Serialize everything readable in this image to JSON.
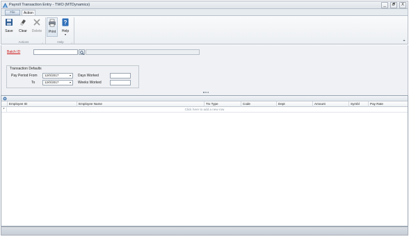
{
  "window": {
    "title": "Payroll Transaction Entry  -  TWO (MTDynamics)",
    "controls": {
      "minimize": "_",
      "restore": "🗗",
      "close": "X"
    }
  },
  "ribbon": {
    "tabs": {
      "file": "File",
      "action": "Action"
    },
    "buttons": {
      "save": "Save",
      "clear": "Clear",
      "delete": "Delete",
      "print": "Print",
      "help": "Help"
    },
    "groups": {
      "actions": "Actions",
      "help": "Help"
    }
  },
  "form": {
    "batch_id_label": "Batch ID",
    "batch_id_value": "",
    "transaction_defaults_label": "Transaction Defaults",
    "pay_period_from_label": "Pay Period From",
    "pay_period_from_value": "12/0/2017",
    "to_label": "To",
    "to_value": "12/0/2017",
    "days_worked_label": "Days Worked",
    "weeks_worked_label": "Weeks Worked"
  },
  "grid": {
    "columns": [
      "Employee ID",
      "Employee Name",
      "Trx Type",
      "Code",
      "Dept",
      "Amount",
      "Symbl",
      "Pay Rate"
    ],
    "new_row_text": "Click here to add a new row",
    "new_row_indicator": "*"
  },
  "colors": {
    "accent_link": "#cc1111",
    "window_border": "#b8bfc8"
  }
}
